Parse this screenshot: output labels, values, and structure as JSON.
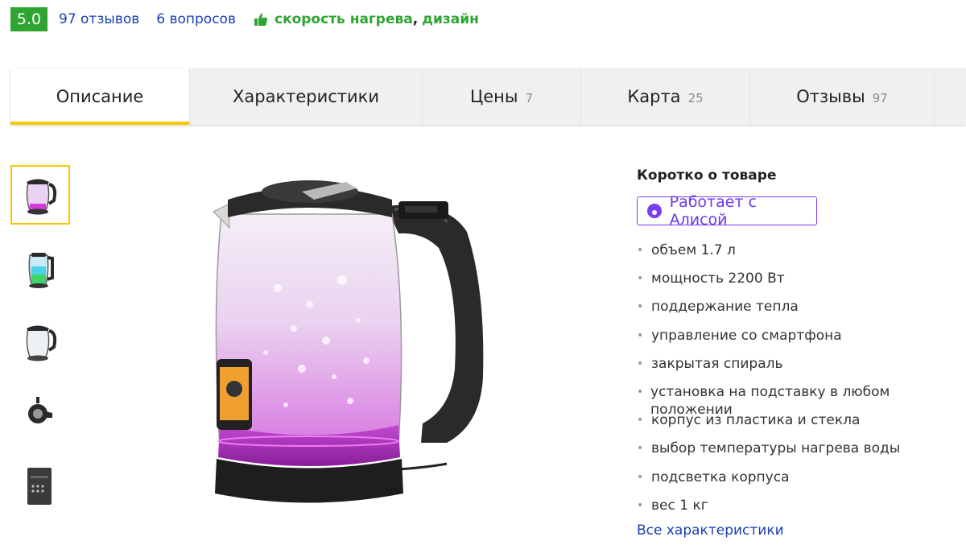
{
  "rating": {
    "score": "5.0",
    "reviews_link": "97 отзывов",
    "questions_link": "6 вопросов",
    "pros": [
      "скорость нагрева",
      "дизайн"
    ],
    "pros_separator": ","
  },
  "tabs": [
    {
      "label": "Описание",
      "count": "",
      "active": true
    },
    {
      "label": "Характеристики",
      "count": ""
    },
    {
      "label": "Цены",
      "count": "7"
    },
    {
      "label": "Карта",
      "count": "25"
    },
    {
      "label": "Отзывы",
      "count": "97"
    }
  ],
  "gallery": {
    "thumbnails": [
      {
        "icon": "kettle-pink-thumbnail",
        "selected": true
      },
      {
        "icon": "kettle-green-thumbnail"
      },
      {
        "icon": "kettle-clear-thumbnail"
      },
      {
        "icon": "kettle-top-view-thumbnail"
      },
      {
        "icon": "kettle-control-panel-thumbnail"
      }
    ],
    "main_image_icon": "glass-kettle-pink-glow-image"
  },
  "summary": {
    "title": "Коротко о товаре",
    "alice_button": "Работает с Алисой",
    "features": [
      "объем 1.7 л",
      "мощность 2200 Вт",
      "поддержание тепла",
      "управление со смартфона",
      "закрытая спираль",
      "установка на подставку в любом положении",
      "корпус из пластика и стекла",
      "выбор температуры нагрева воды",
      "подсветка корпуса",
      "вес 1 кг"
    ],
    "all_specs_link": "Все характеристики"
  },
  "colors": {
    "rating_green": "#2ea532",
    "link_blue": "#1a3fb0",
    "tab_active_underline": "#f5c800",
    "alice_purple": "#7b3ff2"
  }
}
